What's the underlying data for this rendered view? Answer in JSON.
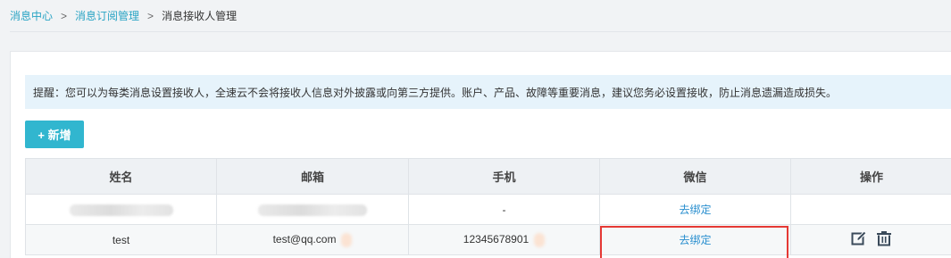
{
  "breadcrumb": {
    "items": [
      "消息中心",
      "消息订阅管理"
    ],
    "separator": ">",
    "current": "消息接收人管理"
  },
  "notice": {
    "text": "提醒：您可以为每类消息设置接收人，全速云不会将接收人信息对外披露或向第三方提供。账户、产品、故障等重要消息，建议您务必设置接收，防止消息遗漏造成损失。"
  },
  "toolbar": {
    "add_label": "+ 新增"
  },
  "table": {
    "headers": [
      "姓名",
      "邮箱",
      "手机",
      "微信",
      "操作"
    ],
    "rows": [
      {
        "name": "",
        "email": "",
        "phone": "-",
        "wechat": "去绑定"
      },
      {
        "name": "test",
        "email": "test@qq.com",
        "phone": "12345678901",
        "wechat": "去绑定"
      }
    ]
  },
  "icons": {
    "edit": "edit-icon",
    "delete": "trash-icon"
  },
  "colors": {
    "accent": "#31b6cf",
    "link": "#2a8fcf",
    "breadcrumb_link": "#2aa4c4",
    "notice_bg": "#e6f3fb",
    "highlight": "#e53935"
  }
}
